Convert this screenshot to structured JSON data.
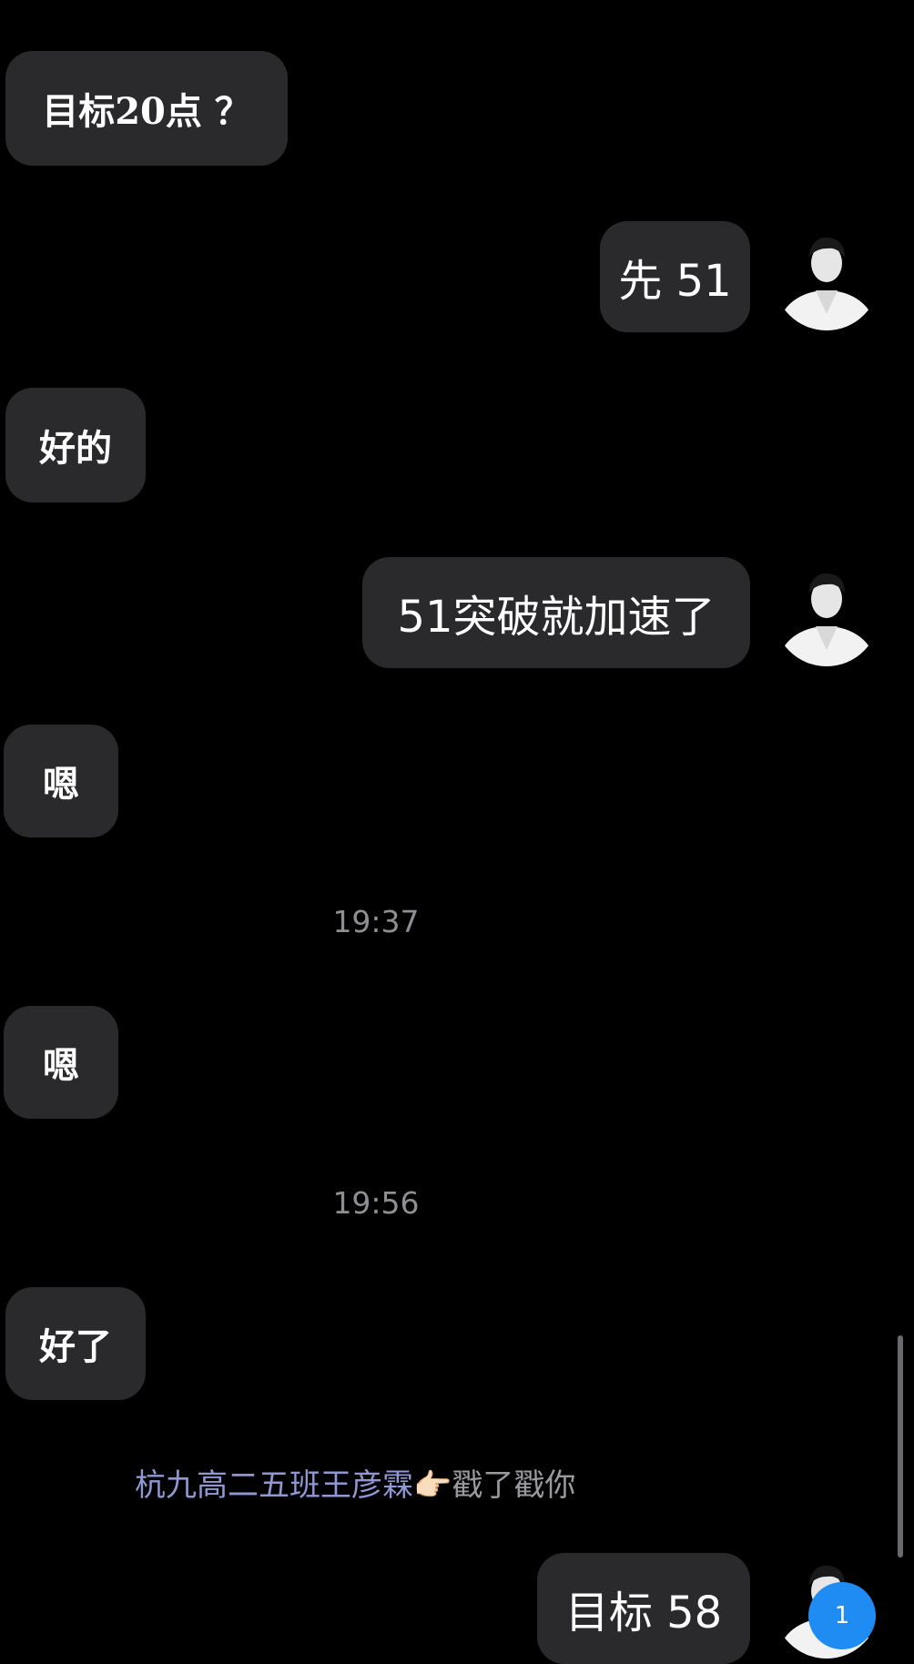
{
  "messages": [
    {
      "side": "in",
      "text": "目标20点 ？"
    },
    {
      "side": "out",
      "text": "先 51"
    },
    {
      "side": "in",
      "text": "好的"
    },
    {
      "side": "out",
      "text": "51突破就加速了"
    },
    {
      "side": "in",
      "text": "嗯"
    },
    {
      "side": "in",
      "text": "嗯"
    },
    {
      "side": "in",
      "text": "好了"
    },
    {
      "side": "out",
      "text": "目标 58"
    }
  ],
  "timestamps": [
    "19:37",
    "19:56"
  ],
  "poke": {
    "name": "杭九高二五班王彦霖",
    "emoji": "👉🏻",
    "action": "戳了戳你"
  },
  "unread_badge": "1",
  "colors": {
    "background": "#000000",
    "bubble": "#2a2a2c",
    "poke_name": "#8f98d4",
    "badge": "#1e8cf2"
  },
  "icons": [
    "avatar-image",
    "pointing-hand-emoji"
  ]
}
